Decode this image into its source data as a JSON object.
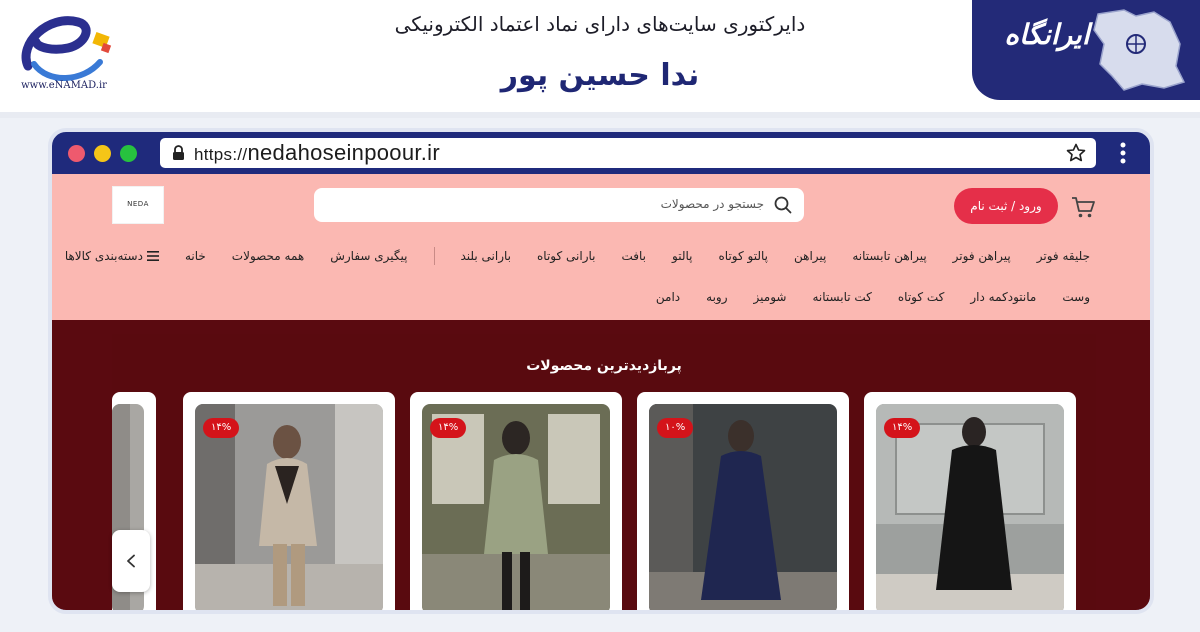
{
  "directory": {
    "title": "دایرکتوری سایت‌های دارای نماد اعتماد الکترونیکی",
    "name": "ندا حسین پور",
    "enamad_url": "www.eNAMAD.ir",
    "irangah_label": "ایرانگاه"
  },
  "browser": {
    "url_protocol": "https://",
    "url_domain": "nedahoseinpoour.ir"
  },
  "site": {
    "logo_text": "NEDA",
    "login_label": "ورود / ثبت نام",
    "search_placeholder": "جستجو در محصولات",
    "nav_row1": [
      "دسته‌بندی کالاها",
      "خانه",
      "همه محصولات",
      "پیگیری سفارش",
      "بارانی بلند",
      "بارانی کوتاه",
      "بافت",
      "پالتو",
      "پالتو کوتاه",
      "پیراهن",
      "پیراهن تابستانه",
      "پیراهن فوتر",
      "جلیقه فوتر"
    ],
    "nav_row2": [
      "دامن",
      "روبه",
      "شومیز",
      "کت تابستانه",
      "کت کوتاه",
      "مانتودکمه دار",
      "وست"
    ],
    "featured_title": "پربازدیدترین محصولات",
    "products": [
      {
        "badge": "۱۴%",
        "photo": "black-coat"
      },
      {
        "badge": "۱۰%",
        "photo": "navy-dress"
      },
      {
        "badge": "۱۴%",
        "photo": "sage-coat"
      },
      {
        "badge": "۱۴%",
        "photo": "beige-blazer"
      }
    ]
  },
  "colors": {
    "brand_navy": "#232a78",
    "site_pink": "#fbb8b2",
    "login_red": "#e52f49",
    "featured_maroon": "#5a0a10",
    "badge_red": "#d4131a"
  }
}
